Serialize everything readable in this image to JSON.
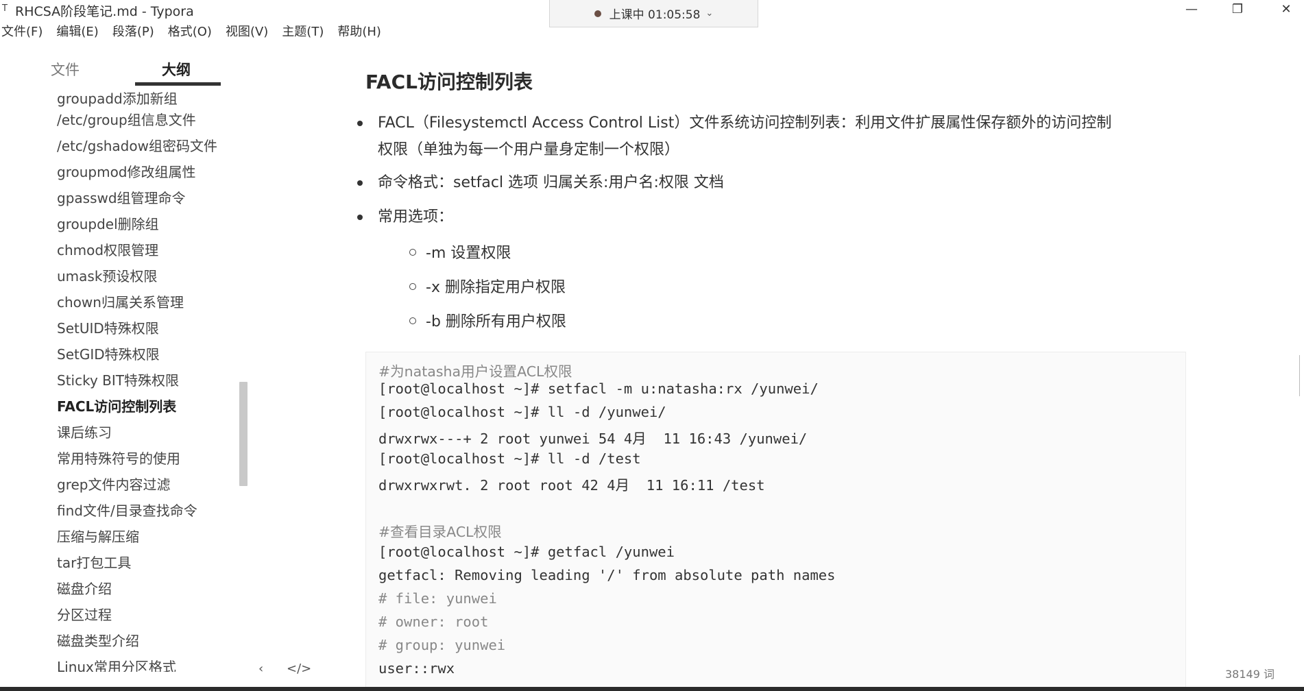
{
  "window": {
    "icon": "T",
    "title": "RHCSA阶段笔记.md - Typora",
    "recording": "上课中 01:05:58",
    "recording_chevron": "⌄",
    "minimize": "—",
    "maximize": "❐",
    "close": "✕"
  },
  "menu": [
    "文件(F)",
    "编辑(E)",
    "段落(P)",
    "格式(O)",
    "视图(V)",
    "主题(T)",
    "帮助(H)"
  ],
  "sidebar": {
    "tabs": [
      "文件",
      "大纲"
    ],
    "active_tab": "大纲",
    "outline": [
      "groupadd添加新组",
      "/etc/group组信息文件",
      "/etc/gshadow组密码文件",
      "groupmod修改组属性",
      "gpasswd组管理命令",
      "groupdel删除组",
      "chmod权限管理",
      "umask预设权限",
      "chown归属关系管理",
      "SetUID特殊权限",
      "SetGID特殊权限",
      "Sticky BIT特殊权限",
      "FACL访问控制列表",
      "课后练习",
      "常用特殊符号的使用",
      "grep文件内容过滤",
      "find文件/目录查找命令",
      "压缩与解压缩",
      "tar打包工具",
      "磁盘介绍",
      "分区过程",
      "磁盘类型介绍",
      "Linux常用分区格式"
    ],
    "active_item": "FACL访问控制列表",
    "footer": {
      "collapse": "‹",
      "source": "</>"
    }
  },
  "content": {
    "heading": "FACL访问控制列表",
    "bullets": [
      {
        "line1": "FACL（Filesystemctl Access Control List）文件系统访问控制列表：利用文件扩展属性保存额外的访问控制",
        "line2": "权限（单独为每一个用户量身定制一个权限）"
      },
      {
        "line1": "命令格式：setfacl 选项 归属关系:用户名:权限 文档"
      },
      {
        "line1": "常用选项："
      }
    ],
    "sub_bullets": [
      "-m 设置权限",
      "-x  删除指定用户权限",
      "-b  删除所有用户权限"
    ],
    "code": [
      "#为natasha用户设置ACL权限",
      "[root@localhost ~]# setfacl -m u:natasha:rx /yunwei/",
      "[root@localhost ~]# ll -d /yunwei/",
      "drwxrwx---+ 2 root yunwei 54 4月  11 16:43 /yunwei/",
      "[root@localhost ~]# ll -d /test",
      "drwxrwxrwt. 2 root root 42 4月  11 16:11 /test",
      "",
      "#查看目录ACL权限",
      "[root@localhost ~]# getfacl /yunwei",
      "getfacl: Removing leading '/' from absolute path names",
      "# file: yunwei",
      "# owner: root",
      "# group: yunwei",
      "user::rwx"
    ]
  },
  "status": {
    "word_count": "38149 词"
  }
}
